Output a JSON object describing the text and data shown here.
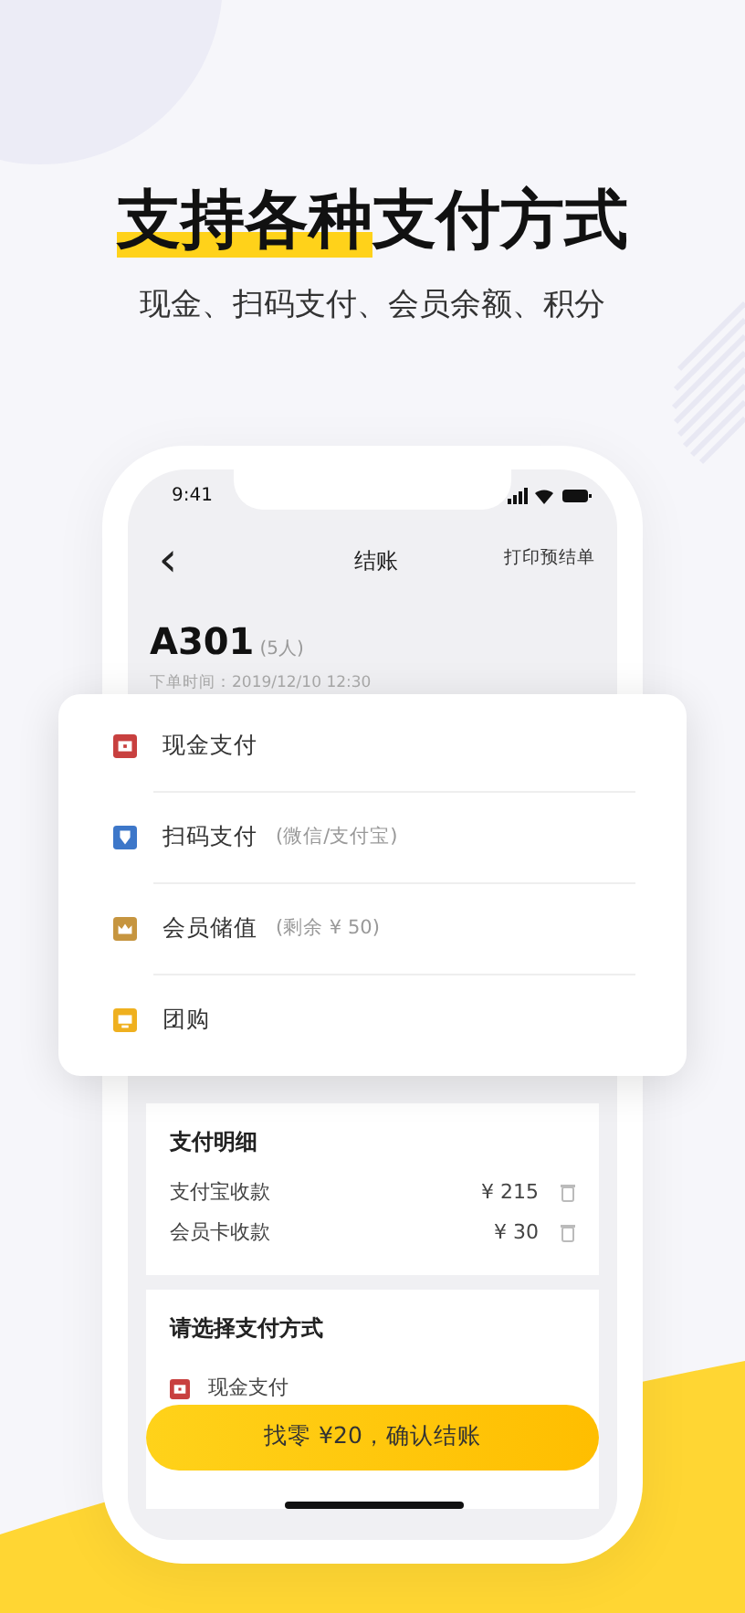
{
  "headline": {
    "highlighted": "支持各种",
    "rest": "支付方式"
  },
  "subtitle": "现金、扫码支付、会员余额、积分",
  "status_bar": {
    "time": "9:41"
  },
  "nav": {
    "back": "‹",
    "title": "结账",
    "action": "打印预结单"
  },
  "order": {
    "table": "A301",
    "guests": "(5人)",
    "time_label": "下单时间：",
    "time": "2019/12/10 12:30"
  },
  "payment_popup": [
    {
      "kind": "cash",
      "label": "现金支付"
    },
    {
      "kind": "scan",
      "label": "扫码支付",
      "note": "(微信/支付宝)"
    },
    {
      "kind": "member",
      "label": "会员储值",
      "note": "(剩余 ¥ 50)"
    },
    {
      "kind": "group",
      "label": "团购"
    }
  ],
  "payment_details": {
    "title": "支付明细",
    "rows": [
      {
        "label": "支付宝收款",
        "amount": "¥ 215"
      },
      {
        "label": "会员卡收款",
        "amount": "¥ 30"
      }
    ]
  },
  "choose_method": {
    "title": "请选择支付方式",
    "options": [
      {
        "kind": "cash",
        "label": "现金支付"
      }
    ]
  },
  "confirm_button": "找零 ¥20，确认结账"
}
